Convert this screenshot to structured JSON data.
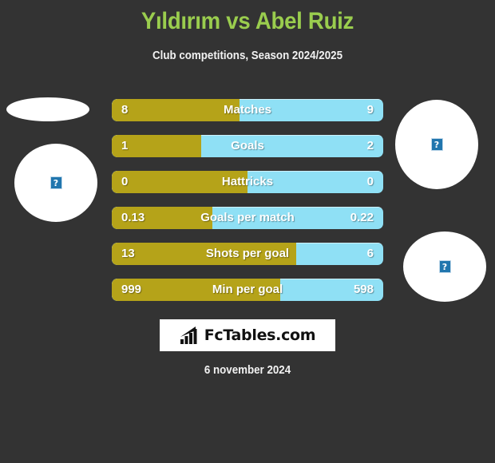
{
  "header": {
    "title": "Yıldırım vs Abel Ruiz",
    "subtitle": "Club competitions, Season 2024/2025",
    "title_color": "#9ACD4E"
  },
  "colors": {
    "background": "#333333",
    "home_bar": "#B5A319",
    "away_bar": "#8FE0F5",
    "text": "#FFFFFF"
  },
  "avatars": [
    {
      "name": "home-player-photo-top",
      "alt_icon": "broken-image-icon",
      "glyph": "?"
    },
    {
      "name": "home-player-photo",
      "alt_icon": "broken-image-icon",
      "glyph": "?"
    },
    {
      "name": "away-player-photo",
      "alt_icon": "broken-image-icon",
      "glyph": "?"
    },
    {
      "name": "away-club-logo",
      "alt_icon": "broken-image-icon",
      "glyph": "?"
    }
  ],
  "chart_data": {
    "type": "bar",
    "title": "Yıldırım vs Abel Ruiz",
    "subtitle": "Club competitions, Season 2024/2025",
    "orientation": "horizontal-diverging",
    "series": [
      {
        "name": "Yıldırım",
        "color": "#B5A319"
      },
      {
        "name": "Abel Ruiz",
        "color": "#8FE0F5"
      }
    ],
    "categories": [
      "Matches",
      "Goals",
      "Hattricks",
      "Goals per match",
      "Shots per goal",
      "Min per goal"
    ],
    "rows": [
      {
        "label": "Matches",
        "home": "8",
        "away": "9",
        "home_pct": 47
      },
      {
        "label": "Goals",
        "home": "1",
        "away": "2",
        "home_pct": 33
      },
      {
        "label": "Hattricks",
        "home": "0",
        "away": "0",
        "home_pct": 50
      },
      {
        "label": "Goals per match",
        "home": "0.13",
        "away": "0.22",
        "home_pct": 37
      },
      {
        "label": "Shots per goal",
        "home": "13",
        "away": "6",
        "home_pct": 68
      },
      {
        "label": "Min per goal",
        "home": "999",
        "away": "598",
        "home_pct": 62
      }
    ]
  },
  "footer": {
    "logo_text": "FcTables.com",
    "logo_icon": "bar-chart-icon",
    "date": "6 november 2024"
  }
}
